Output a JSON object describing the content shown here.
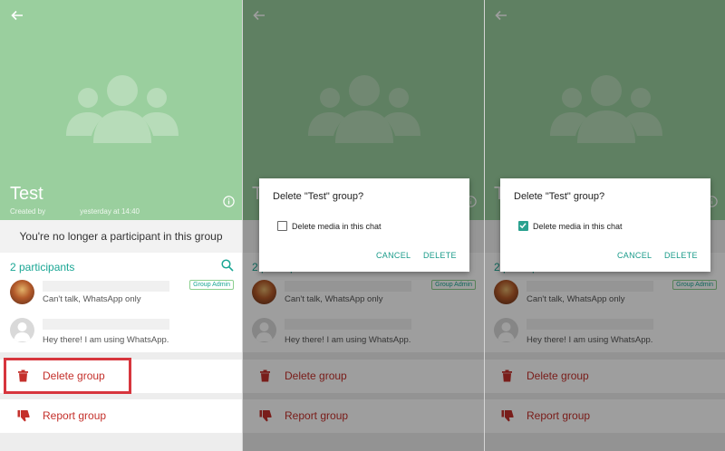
{
  "group": {
    "title": "Test",
    "created_by": "Created by",
    "created_time": "yesterday at 14:40"
  },
  "notice": "You're no longer a participant in this group",
  "participants": {
    "count_label": "2 participants",
    "items": [
      {
        "status": "Can't talk, WhatsApp only",
        "badge": "Group Admin"
      },
      {
        "status": "Hey there! I am using WhatsApp."
      }
    ]
  },
  "actions": {
    "delete_label": "Delete group",
    "report_label": "Report group"
  },
  "dialog": {
    "title": "Delete \"Test\" group?",
    "checkbox_label": "Delete media in this chat",
    "cancel": "CANCEL",
    "delete": "DELETE"
  },
  "panels": [
    {
      "dialog_visible": false,
      "checkbox_checked": false
    },
    {
      "dialog_visible": true,
      "checkbox_checked": false
    },
    {
      "dialog_visible": true,
      "checkbox_checked": true
    }
  ],
  "colors": {
    "header_green": "#9acf9e",
    "accent_teal": "#1aa694",
    "danger_red": "#c4302b",
    "highlight_red": "#d7353d"
  },
  "icons": [
    "back-arrow-icon",
    "group-avatar-icon",
    "info-icon",
    "search-icon",
    "trash-icon",
    "thumbs-down-icon",
    "checkmark-icon"
  ]
}
